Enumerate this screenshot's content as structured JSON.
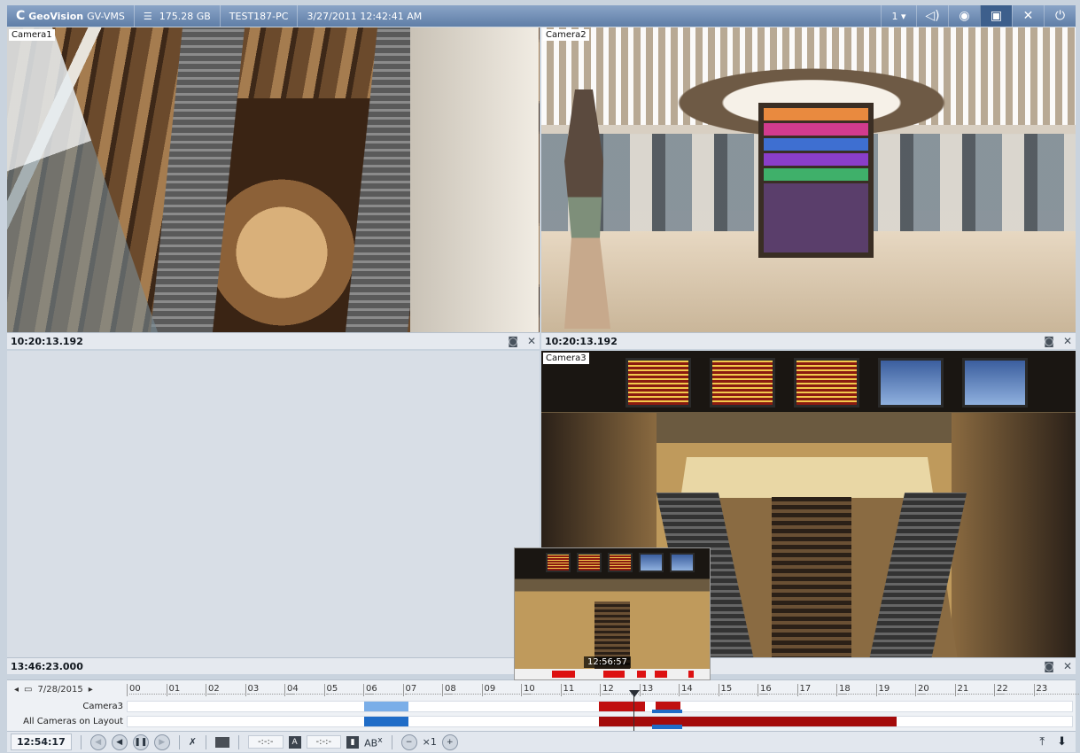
{
  "titlebar": {
    "logo": "GeoVision",
    "app": "GV-VMS",
    "storage": "175.28 GB",
    "host": "TEST187-PC",
    "datetime": "3/27/2011 12:42:41 AM",
    "page": "1 ▾",
    "icons": [
      "speaker-icon",
      "eye-icon",
      "save-icon",
      "tools-icon",
      "power-icon"
    ]
  },
  "cameras": {
    "cam1": {
      "label": "Camera1",
      "time": "10:20:13.192"
    },
    "cam2": {
      "label": "Camera2",
      "time": "10:20:13.192"
    },
    "cam3": {
      "label": "Camera3",
      "time": ""
    },
    "empty": {
      "time": "13:46:23.000"
    }
  },
  "preview": {
    "time": "12:56:57"
  },
  "timeline": {
    "date": "7/28/2015",
    "hours": [
      "00",
      "01",
      "02",
      "03",
      "04",
      "05",
      "06",
      "07",
      "08",
      "09",
      "10",
      "11",
      "12",
      "13",
      "14",
      "15",
      "16",
      "17",
      "18",
      "19",
      "20",
      "21",
      "22",
      "23"
    ],
    "rows": [
      {
        "label": "Camera3"
      },
      {
        "label": "All Cameras on Layout"
      }
    ]
  },
  "bottombar": {
    "clock": "12:54:17",
    "field1": "-:-:-",
    "field2": "-:-:-",
    "box_a": "A",
    "ab": "AB",
    "speed": "×1"
  }
}
